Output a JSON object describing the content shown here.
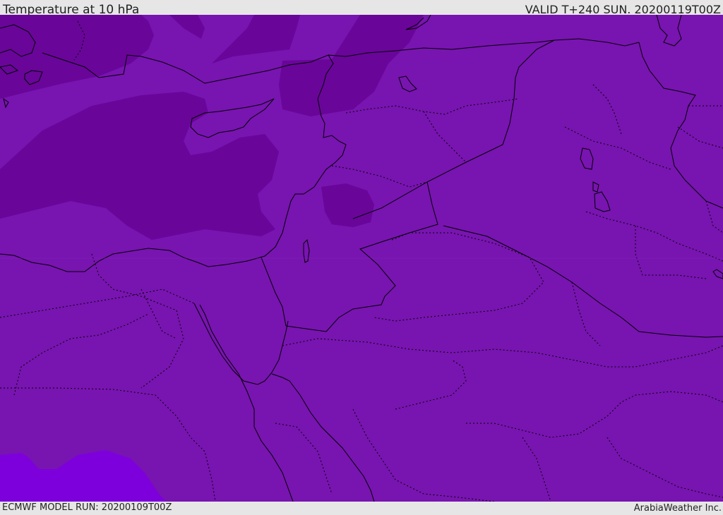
{
  "header": {
    "title": "Temperature at 10 hPa",
    "valid": "VALID T+240 SUN. 20200119T00Z"
  },
  "footer": {
    "model_run": "ECMWF MODEL RUN: 20200109T00Z",
    "credit": "ArabiaWeather Inc."
  },
  "colors": {
    "base_field": "#7814b0",
    "cold_field": "#690599",
    "warm_field": "#7d00dc",
    "coastline": "#000000",
    "frame": "#e6e6e6"
  }
}
